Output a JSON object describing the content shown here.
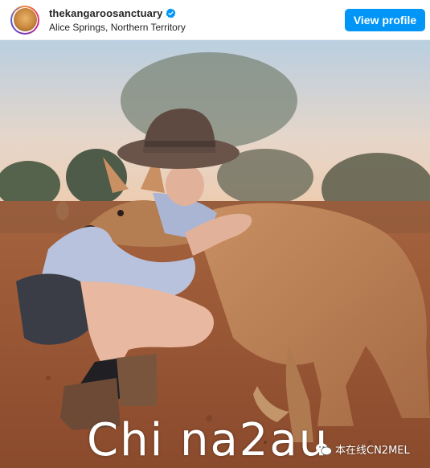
{
  "header": {
    "username": "thekangaroosanctuary",
    "location": "Alice Springs, Northern Territory",
    "view_profile_label": "View profile",
    "verified": true,
    "accent_color": "#0095f6"
  },
  "photo": {
    "icon": "post-image"
  },
  "watermark": {
    "main_text": "Chi na2au",
    "source_text": "本在线CN2MEL",
    "source_icon": "wechat-icon"
  }
}
